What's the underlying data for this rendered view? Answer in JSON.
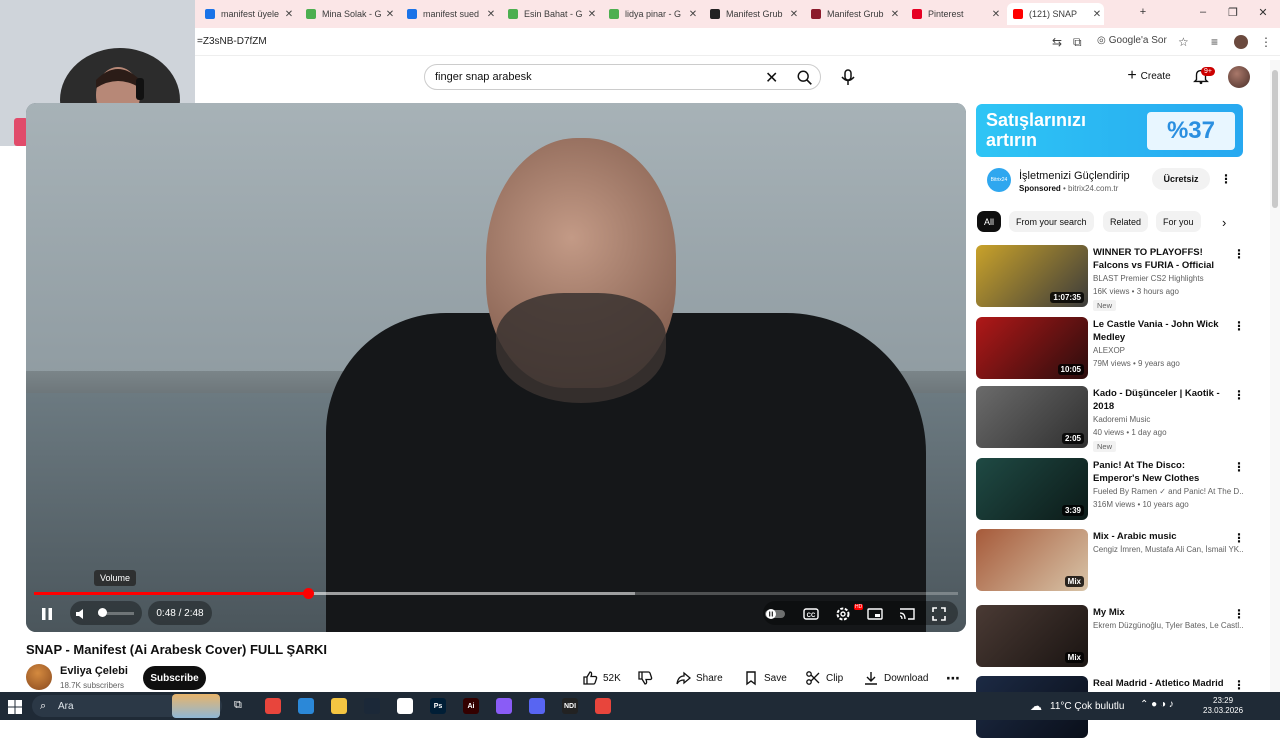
{
  "browser": {
    "tabs": [
      {
        "label": "manifest üyele",
        "color": "#1a73e8"
      },
      {
        "label": "Mina Solak - G",
        "color": "#4caf50"
      },
      {
        "label": "manifest sued",
        "color": "#1a73e8"
      },
      {
        "label": "Esin Bahat - G",
        "color": "#4caf50"
      },
      {
        "label": "lidya pinar - G",
        "color": "#4caf50"
      },
      {
        "label": "Manifest Grub",
        "color": "#222222"
      },
      {
        "label": "Manifest Grub",
        "color": "#8b1a2b"
      },
      {
        "label": "Pinterest",
        "color": "#e60023"
      },
      {
        "label": "(121) SNAP",
        "color": "#ff0000"
      }
    ],
    "url": "=Z3sNB-D7fZM",
    "translate_label": "Google'a Sor"
  },
  "header": {
    "search_query": "finger snap arabesk",
    "create_label": "Create",
    "notifications_badge": "9+"
  },
  "player": {
    "time": "0:48 / 2:48",
    "played_fraction": 0.296,
    "buffered_fraction": 0.65,
    "volume_tooltip": "Volume",
    "volume_fraction": 0.05
  },
  "video": {
    "title": "SNAP - Manifest (Ai Arabesk Cover) FULL ŞARKI",
    "channel_name": "Evliya Çelebi",
    "subscribers": "18.7K subscribers",
    "subscribe_label": "Subscribe",
    "likes": "52K",
    "share_label": "Share",
    "save_label": "Save",
    "clip_label": "Clip",
    "download_label": "Download"
  },
  "ad": {
    "banner_text_line1": "Satışlarınızı",
    "banner_text_line2": "artırın",
    "banner_percent": "%37",
    "title": "İşletmenizi Güçlendirip",
    "sponsored": "Sponsored",
    "domain": "bitrix24.com.tr",
    "cta": "Ücretsiz",
    "logo_text": "Bitrix24"
  },
  "chips": [
    "All",
    "From your search",
    "Related",
    "For you"
  ],
  "recommendations": [
    {
      "title": "WINNER TO PLAYOFFS! Falcons vs FURIA - Official Highlights - ...",
      "channel": "BLAST Premier CS2 Highlights",
      "stats": "16K views • 3 hours ago",
      "badge": "New",
      "duration": "1:07:35",
      "thumb_colors": [
        "#c9a22a",
        "#3b3b3b"
      ]
    },
    {
      "title": "Le Castle Vania - John Wick Medley",
      "channel": "ALEXOP",
      "stats": "79M views • 9 years ago",
      "badge": "",
      "duration": "10:05",
      "thumb_colors": [
        "#b01818",
        "#2a0d0d"
      ]
    },
    {
      "title": "Kado - Düşünceler | Kaotik - 2018",
      "channel": "Kadoremi Music",
      "stats": "40 views • 1 day ago",
      "badge": "New",
      "duration": "2:05",
      "thumb_colors": [
        "#6b6b6b",
        "#2f2f2f"
      ]
    },
    {
      "title": "Panic! At The Disco: Emperor's New Clothes [OFFICIAL VIDEO]",
      "channel": "Fueled By Ramen ✓ and Panic! At The D...",
      "stats": "316M views • 10 years ago",
      "badge": "",
      "duration": "3:39",
      "thumb_colors": [
        "#1f4a44",
        "#0c1a18"
      ]
    },
    {
      "title": "Mix - Arabic music",
      "channel": "Cengiz İmren, Mustafa Ali Can, İsmail YK...",
      "stats": "",
      "badge": "",
      "duration": "Mix",
      "thumb_colors": [
        "#a65a3a",
        "#d8c4a8"
      ]
    },
    {
      "title": "My Mix",
      "channel": "Ekrem Düzgünoğlu, Tyler Bates, Le Castl...",
      "stats": "",
      "badge": "",
      "duration": "Mix",
      "thumb_colors": [
        "#4a3a34",
        "#1a1412"
      ]
    },
    {
      "title": "Real Madrid - Atletico Madrid",
      "channel": "",
      "stats": "",
      "badge": "",
      "duration": "",
      "thumb_colors": [
        "#1c2a44",
        "#0a0f1a"
      ]
    }
  ],
  "taskbar": {
    "search_label": "Ara",
    "weather": "11°C  Çok bulutlu",
    "time": "23:29",
    "date": "23.03.2026",
    "apps": [
      {
        "name": "chrome",
        "color": "#e8453c",
        "text": ""
      },
      {
        "name": "store",
        "color": "#2b88d8",
        "text": ""
      },
      {
        "name": "explorer",
        "color": "#f4c542",
        "text": ""
      },
      {
        "name": "steam",
        "color": "#1b2838",
        "text": ""
      },
      {
        "name": "notes",
        "color": "#ffffff",
        "text": ""
      },
      {
        "name": "photoshop",
        "color": "#001e36",
        "text": "Ps"
      },
      {
        "name": "illustrator",
        "color": "#330000",
        "text": "Ai"
      },
      {
        "name": "figma",
        "color": "#8a5cf6",
        "text": ""
      },
      {
        "name": "discord",
        "color": "#5865f2",
        "text": ""
      },
      {
        "name": "ndi",
        "color": "#222222",
        "text": "NDI"
      },
      {
        "name": "chrome-2",
        "color": "#e8453c",
        "text": ""
      }
    ]
  }
}
